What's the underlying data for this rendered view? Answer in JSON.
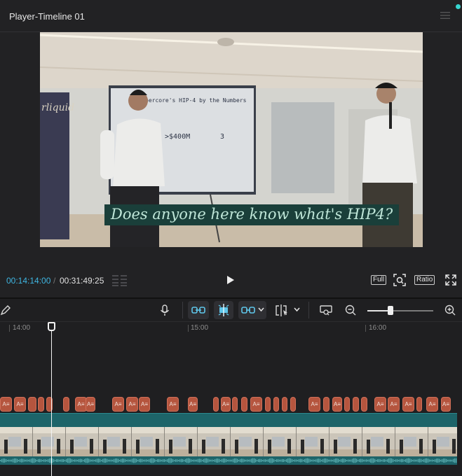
{
  "player": {
    "title": "Player-Timeline 01",
    "timecode_current": "00:14:14:00",
    "timecode_separator": "/",
    "timecode_total": "00:31:49:25",
    "subtitle": "Does anyone here know what's HIP4?",
    "slide_heading": "percore's HIP-4 by the Numbers",
    "slide_stat_1": ">$400M",
    "slide_stat_2": "3",
    "banner_text": "rliquid",
    "full_label": "Full",
    "ratio_label": "Ratio",
    "accent_color": "#3fb6e2"
  },
  "timeline": {
    "ruler_labels": [
      "14:00",
      "15:00",
      "16:00"
    ],
    "caption_clip_label": "A≡",
    "icons": [
      "pen-icon",
      "microphone-icon",
      "link-icon",
      "split-icon",
      "link-chain-icon",
      "split-cursor-icon",
      "preview-icon",
      "zoom-out-icon",
      "zoom-in-icon"
    ],
    "zoom_level": 0.35,
    "caption_color": "#b5553e",
    "video_track_color": "#1d6469"
  }
}
